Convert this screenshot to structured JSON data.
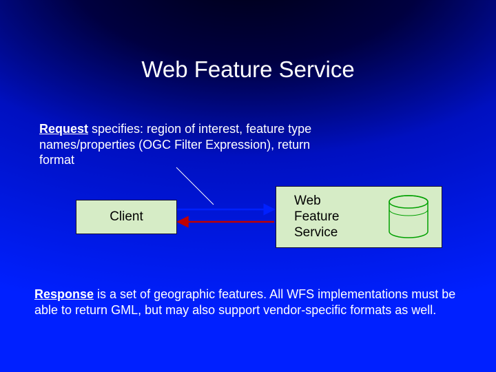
{
  "title": "Web Feature Service",
  "request": {
    "lead": "Request",
    "body": " specifies: region of interest, feature type names/properties (OGC Filter Expression), return format"
  },
  "client": {
    "label": "Client"
  },
  "wfs": {
    "label_line1": "Web",
    "label_line2": "Feature",
    "label_line3": "Service"
  },
  "response": {
    "lead": "Response",
    "body": " is a set of geographic features.  All WFS implementations must be able to return GML, but may also support vendor-specific formats as well."
  },
  "colors": {
    "box_fill": "#d6ecc6",
    "arrow_request": "#0020ff",
    "arrow_response": "#c00000"
  }
}
